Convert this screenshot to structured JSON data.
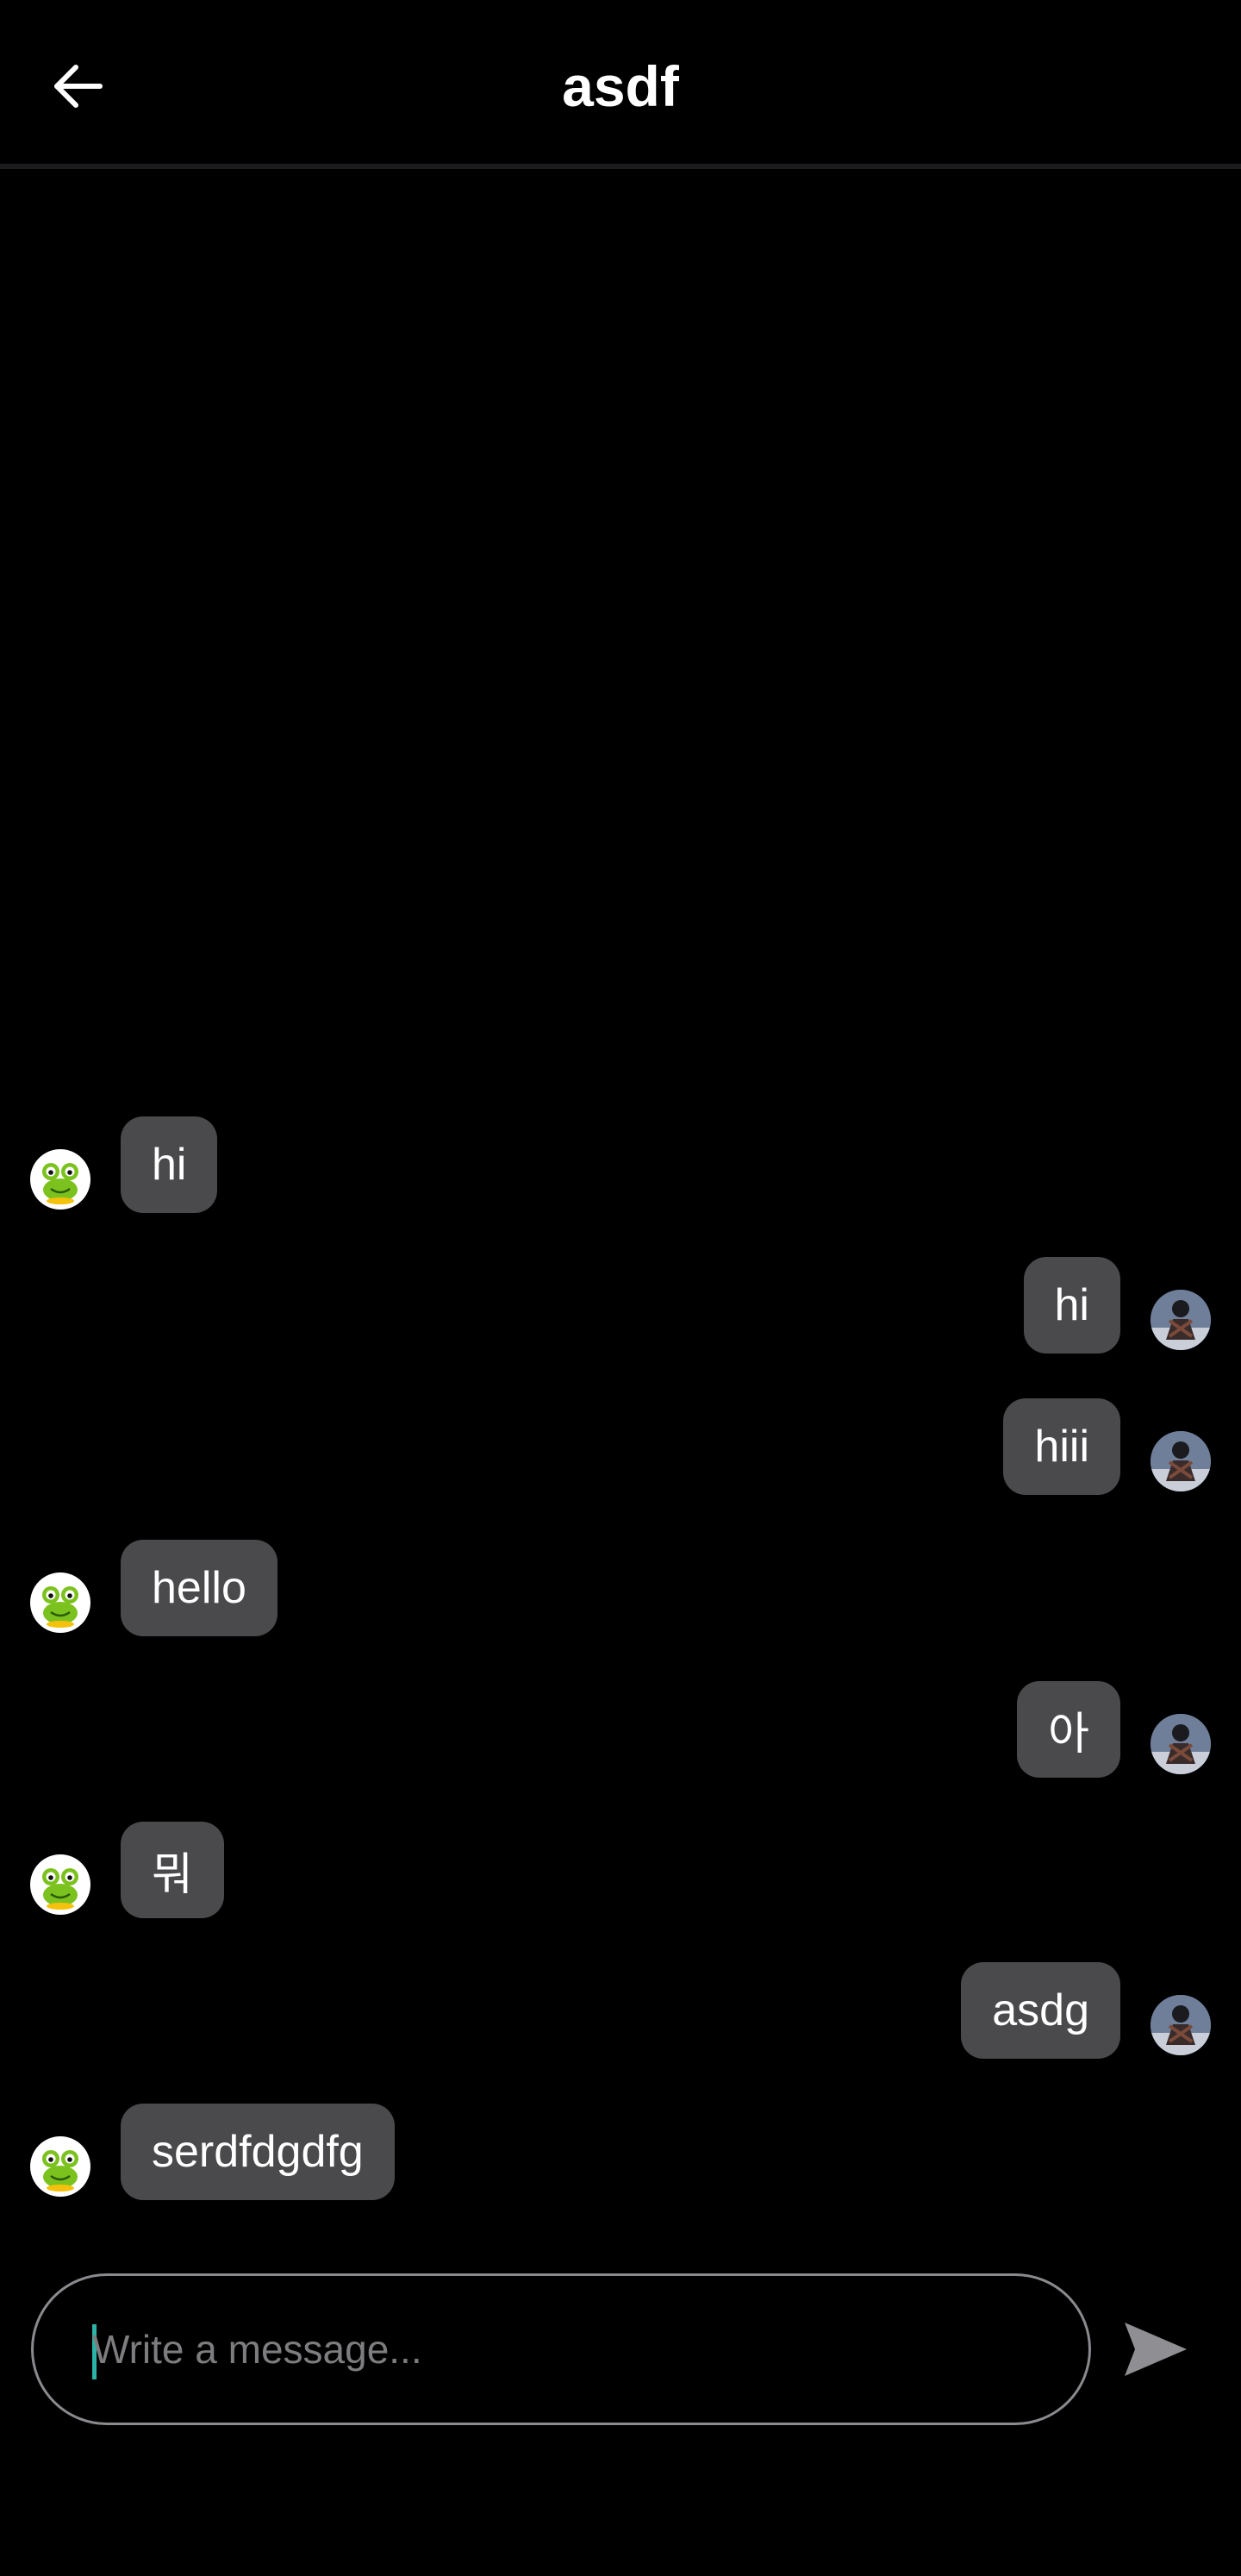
{
  "header": {
    "title": "asdf",
    "back_icon": "arrow-left-icon"
  },
  "messages": [
    {
      "side": "left",
      "text": "hi",
      "avatar": "frog-avatar"
    },
    {
      "side": "right",
      "text": "hi",
      "avatar": "user-photo-avatar"
    },
    {
      "side": "right",
      "text": "hiii",
      "avatar": "user-photo-avatar"
    },
    {
      "side": "left",
      "text": "hello",
      "avatar": "frog-avatar"
    },
    {
      "side": "right",
      "text": "아",
      "avatar": "user-photo-avatar"
    },
    {
      "side": "left",
      "text": "뭐",
      "avatar": "frog-avatar"
    },
    {
      "side": "right",
      "text": "asdg",
      "avatar": "user-photo-avatar"
    },
    {
      "side": "left",
      "text": "serdfdgdfg",
      "avatar": "frog-avatar"
    }
  ],
  "composer": {
    "placeholder": "Write a message...",
    "value": "",
    "send_icon": "send-icon"
  },
  "colors": {
    "background": "#000000",
    "bubble": "#4a4a4c",
    "caret": "#2bb3a8",
    "input_border": "#8a8a8e"
  }
}
